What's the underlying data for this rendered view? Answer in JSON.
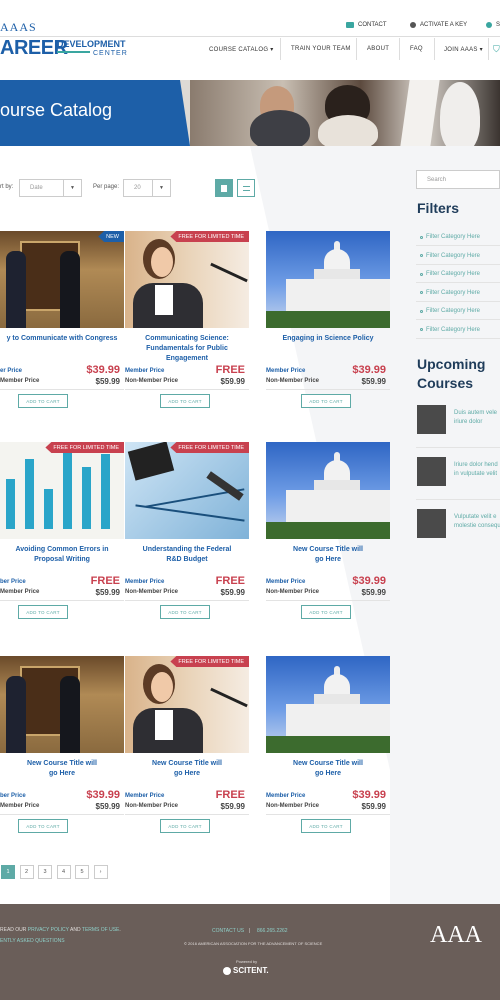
{
  "header": {
    "logo_top": "AAAS",
    "logo_main": "AREER",
    "logo_dev": "DEVELOPMENT",
    "logo_center": "CENTER",
    "utility": [
      {
        "label": "CONTACT",
        "icon": "mail-icon"
      },
      {
        "label": "ACTIVATE A KEY",
        "icon": "key-icon"
      },
      {
        "label": "S",
        "icon": "user-icon"
      }
    ],
    "nav": [
      {
        "label": "COURSE CATALOG ▾"
      },
      {
        "label": "TRAIN YOUR TEAM"
      },
      {
        "label": "ABOUT"
      },
      {
        "label": "FAQ"
      },
      {
        "label": "JOIN AAAS ▾"
      }
    ]
  },
  "hero": {
    "title": "ourse Catalog"
  },
  "toolbar": {
    "sort_label": "rt by:",
    "sort_value": "Date",
    "perpage_label": "Per page:",
    "perpage_value": "20"
  },
  "sidebar": {
    "search_placeholder": "Search",
    "filters_title": "Filters",
    "filters": [
      "Filter Category Here",
      "Filter Category Here",
      "Filter Category Here",
      "Filter Category Here",
      "Filter Category Here",
      "Filter Category Here"
    ],
    "upcoming_title_1": "Upcoming",
    "upcoming_title_2": "Courses",
    "upcoming": [
      {
        "line1": "Duis autem vele",
        "line2": "iriure dolor"
      },
      {
        "line1": "Iriure dolor hend",
        "line2": "in vulputate velit"
      },
      {
        "line1": "Vulputate velit e",
        "line2": "molestie consequ"
      }
    ]
  },
  "cards": [
    {
      "title1": "y to Communicate with Congress",
      "title2": "",
      "member_price": "$39.99",
      "nonmember_price": "$59.99",
      "badge": "NEW",
      "badge_type": "new",
      "member_label": "er Price",
      "nonmember_label": "Member Price",
      "image": "handshake"
    },
    {
      "title1": "Communicating Science:",
      "title2": "Fundamentals for Public Engagement",
      "member_price": "FREE",
      "nonmember_price": "$59.99",
      "badge": "FREE FOR LIMITED TIME",
      "badge_type": "free",
      "member_label": "Member Price",
      "nonmember_label": "Non-Member Price",
      "image": "speaker"
    },
    {
      "title1": "Engaging in Science Policy",
      "title2": "",
      "member_price": "$39.99",
      "nonmember_price": "$59.99",
      "badge": "",
      "badge_type": "",
      "member_label": "Member Price",
      "nonmember_label": "Non-Member Price",
      "image": "capitol"
    },
    {
      "title1": "Avoiding Common Errors in",
      "title2": "Proposal Writing",
      "member_price": "FREE",
      "nonmember_price": "$59.99",
      "badge": "FREE FOR LIMITED TIME",
      "badge_type": "free",
      "member_label": "ber Price",
      "nonmember_label": "Member Price",
      "image": "bars"
    },
    {
      "title1": "Understanding the Federal",
      "title2": "R&D Budget",
      "member_price": "FREE",
      "nonmember_price": "$59.99",
      "badge": "FREE FOR LIMITED TIME",
      "badge_type": "free",
      "member_label": "Member Price",
      "nonmember_label": "Non-Member Price",
      "image": "calculator"
    },
    {
      "title1": "New Course Title will",
      "title2": "go Here",
      "member_price": "$39.99",
      "nonmember_price": "$59.99",
      "badge": "",
      "badge_type": "",
      "member_label": "Member Price",
      "nonmember_label": "Non-Member Price",
      "image": "capitol"
    },
    {
      "title1": "New Course Title will",
      "title2": "go Here",
      "member_price": "$39.99",
      "nonmember_price": "$59.99",
      "badge": "",
      "badge_type": "",
      "member_label": "ber Price",
      "nonmember_label": "Member Price",
      "image": "handshake"
    },
    {
      "title1": "New Course Title will",
      "title2": "go Here",
      "member_price": "FREE",
      "nonmember_price": "$59.99",
      "badge": "FREE FOR LIMITED TIME",
      "badge_type": "free",
      "member_label": "Member Price",
      "nonmember_label": "Non-Member Price",
      "image": "speaker"
    },
    {
      "title1": "New Course Title will",
      "title2": "go Here",
      "member_price": "$39.99",
      "nonmember_price": "$59.99",
      "badge": "",
      "badge_type": "",
      "member_label": "Member Price",
      "nonmember_label": "Non-Member Price",
      "image": "capitol"
    }
  ],
  "add_to_cart": "ADD TO CART",
  "pagination": [
    "1",
    "2",
    "3",
    "4",
    "5",
    "›"
  ],
  "pagination_active": "1",
  "footer": {
    "line1_prefix": "READ OUR ",
    "privacy": "PRIVACY POLICY",
    "and": " AND ",
    "terms": "TERMS OF USE",
    "line1_suffix": ".",
    "faq": "ENTLY ASKED QUESTIONS",
    "contact": "CONTACT US",
    "sep": "|",
    "phone": "866.265.2262",
    "copyright": "© 2016 AMERICAN ASSOCIATION FOR THE ADVANCEMENT OF SCIENCE",
    "powered": "Powered by",
    "scitent": "SCITENT.",
    "logo_right": "AAA"
  },
  "colors": {
    "brand_blue": "#1d5fa8",
    "teal": "#5eaaa6",
    "red": "#c8414f",
    "footer": "#6a5e59"
  }
}
